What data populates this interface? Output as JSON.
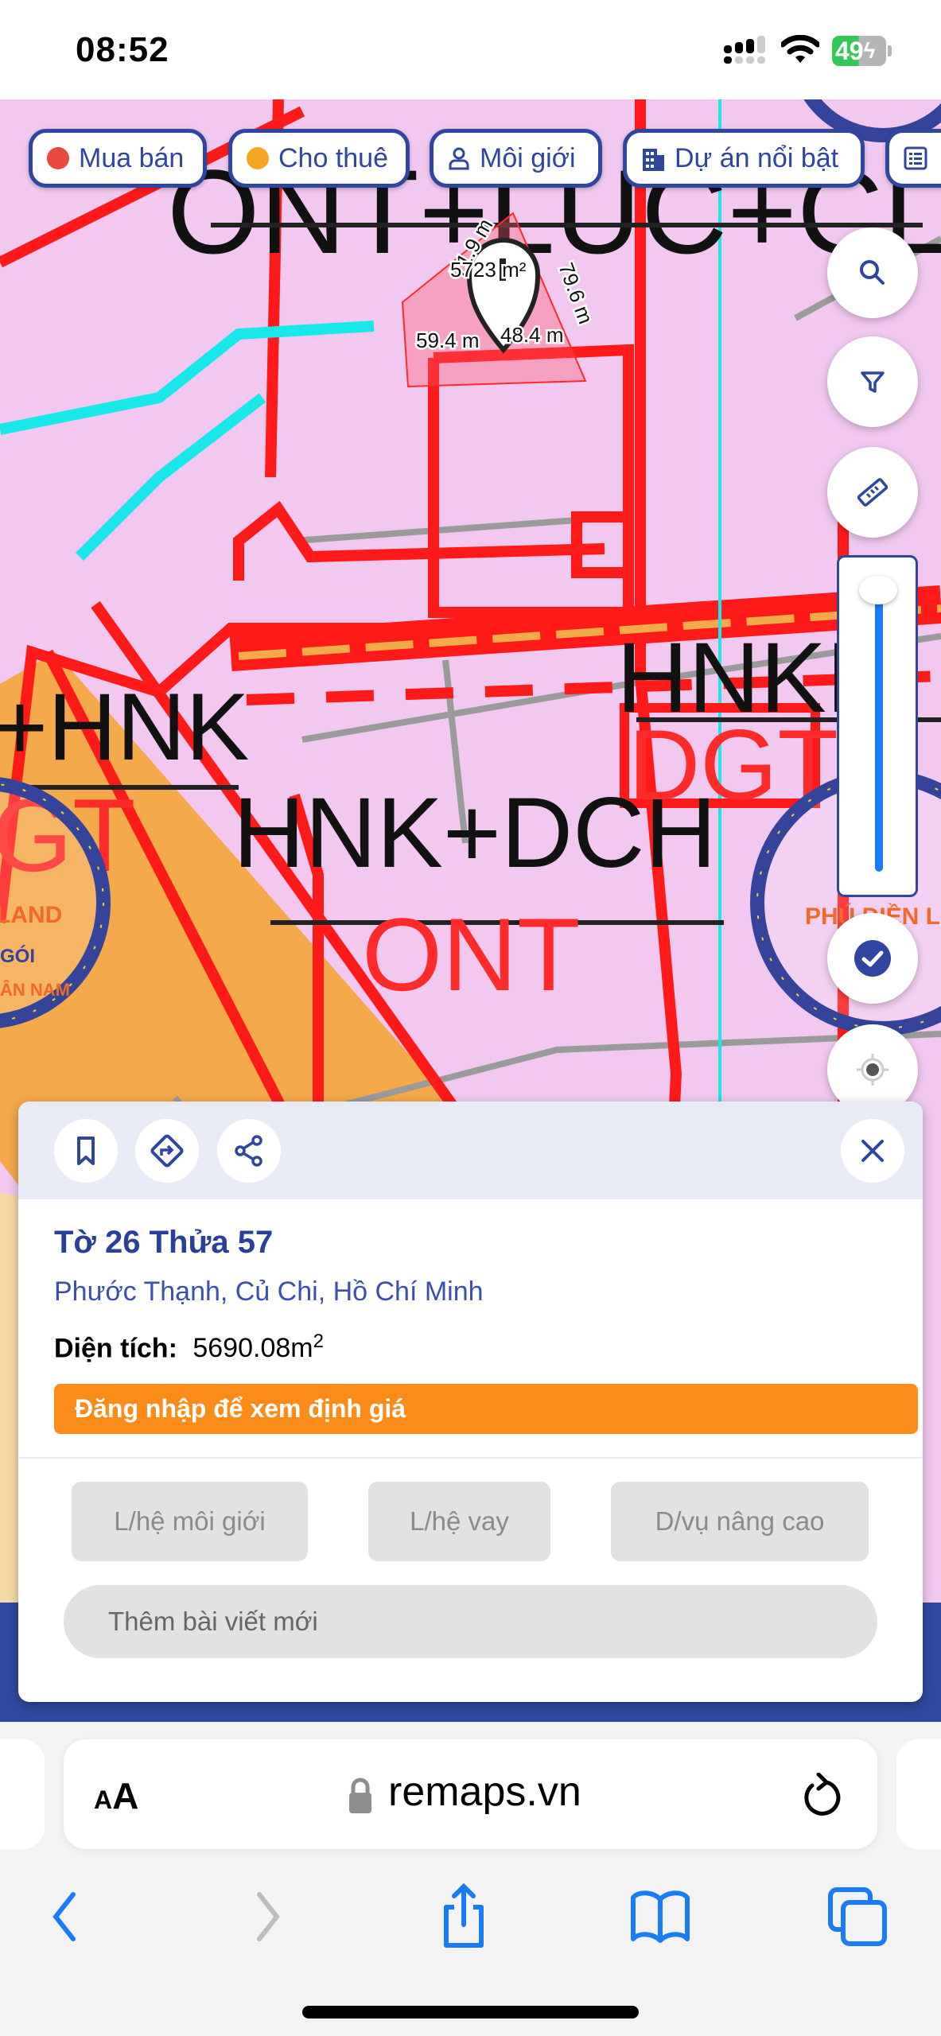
{
  "status_bar": {
    "time": "08:52",
    "battery": "49",
    "icons": [
      "cellular-signal-icon",
      "wifi-icon",
      "battery-charging-icon"
    ]
  },
  "map": {
    "chips": [
      {
        "label": "Mua bán",
        "icon": "red-dot",
        "color": "#e8483f"
      },
      {
        "label": "Cho thuê",
        "icon": "orange-dot",
        "color": "#f6a623"
      },
      {
        "label": "Môi giới",
        "icon": "person-icon"
      },
      {
        "label": "Dự án nổi bật",
        "icon": "building-icon"
      },
      {
        "label": "",
        "icon": "list-icon"
      }
    ],
    "labels": {
      "top": "ONT+LUC+CLN",
      "left": "+HNK",
      "center": "HNK+DCH",
      "center_sub": "ONT",
      "right": "HNKD",
      "right_sub": "DGT",
      "left_sub": "GT"
    },
    "parcel": {
      "area": "5723 m²",
      "edges": [
        "71.9 m",
        "79.6 m",
        "59.4 m",
        "48.4 m"
      ]
    },
    "watermark": {
      "brand": "PHÚ ĐIỀN LAND",
      "left_fragment": "LAND",
      "left_line": "GÓI",
      "left_line2": "ÂN NAM"
    },
    "zoom_level_percent": 100,
    "controls": [
      "search-icon",
      "filter-icon",
      "ruler-icon",
      "check-icon",
      "locate-icon"
    ],
    "colors": {
      "accent": "#2f45a0",
      "land_pink": "#f2c8f0",
      "road_red": "#ff1a1a",
      "orange": "#f4a94a"
    }
  },
  "panel": {
    "title": "Tờ 26 Thửa 57",
    "address": "Phước Thạnh, Củ Chi, Hồ Chí Minh",
    "area_label": "Diện tích:",
    "area_value": "5690.08m",
    "area_unit_sup": "2",
    "login_banner": "Đăng nhập để xem định giá",
    "buttons": [
      "L/hệ môi giới",
      "L/hệ vay",
      "D/vụ nâng cao"
    ],
    "new_post": "Thêm bài viết mới",
    "header_icons": [
      "bookmark-icon",
      "directions-icon",
      "share-icon",
      "close-icon"
    ]
  },
  "browser": {
    "aa": "AA",
    "url": "remaps.vn"
  }
}
